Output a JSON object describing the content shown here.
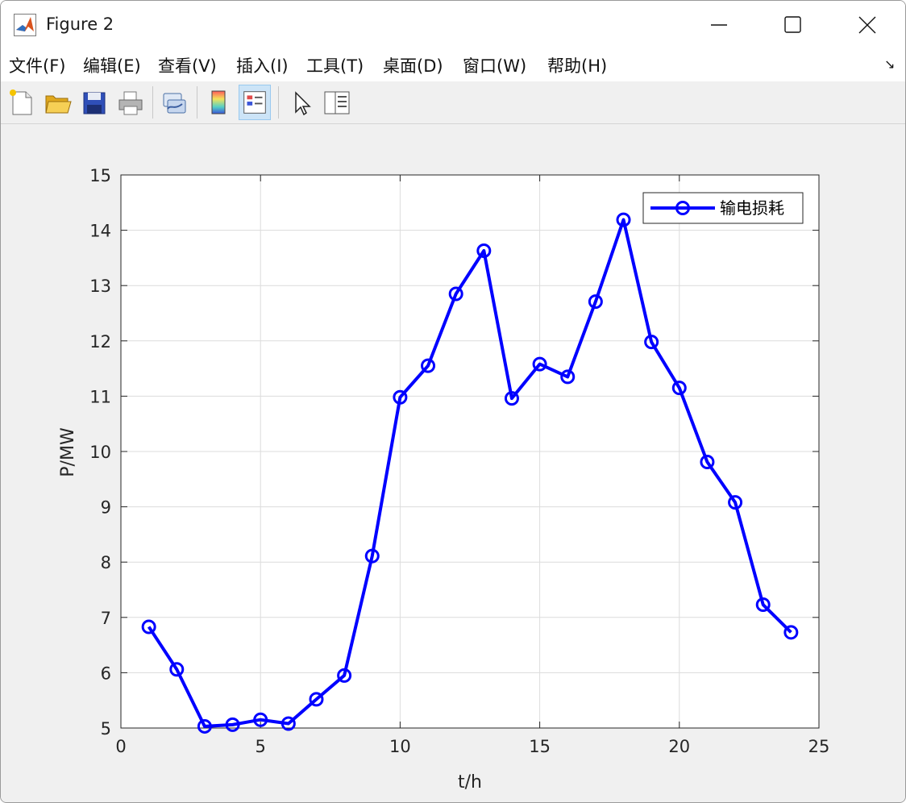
{
  "window": {
    "title": "Figure 2"
  },
  "menu": {
    "items": [
      "文件(F)",
      "编辑(E)",
      "查看(V)",
      "插入(I)",
      "工具(T)",
      "桌面(D)",
      "窗口(W)",
      "帮助(H)"
    ],
    "toolbar_toggle": "↘"
  },
  "toolbar": {
    "buttons": [
      "new-figure",
      "open-file",
      "save-figure",
      "print-figure",
      "link-plot",
      "insert-colorbar",
      "insert-legend",
      "edit-plot",
      "open-property-inspector"
    ]
  },
  "chart_data": {
    "type": "line",
    "title": "",
    "xlabel": "t/h",
    "ylabel": "P/MW",
    "xlim": [
      0,
      25
    ],
    "ylim": [
      5,
      15
    ],
    "xticks": [
      0,
      5,
      10,
      15,
      20,
      25
    ],
    "yticks": [
      5,
      6,
      7,
      8,
      9,
      10,
      11,
      12,
      13,
      14,
      15
    ],
    "grid": true,
    "legend_position": "top-right",
    "series": [
      {
        "name": "输电损耗",
        "color": "#0000ff",
        "marker": "circle",
        "x": [
          1,
          2,
          3,
          4,
          5,
          6,
          7,
          8,
          9,
          10,
          11,
          12,
          13,
          14,
          15,
          16,
          17,
          18,
          19,
          20,
          21,
          22,
          23,
          24
        ],
        "y": [
          6.83,
          6.06,
          5.03,
          5.06,
          5.15,
          5.08,
          5.52,
          5.95,
          8.11,
          10.98,
          11.55,
          12.85,
          13.63,
          10.96,
          11.58,
          11.35,
          12.71,
          14.19,
          11.98,
          11.15,
          9.81,
          9.08,
          7.23,
          6.73
        ]
      }
    ]
  }
}
